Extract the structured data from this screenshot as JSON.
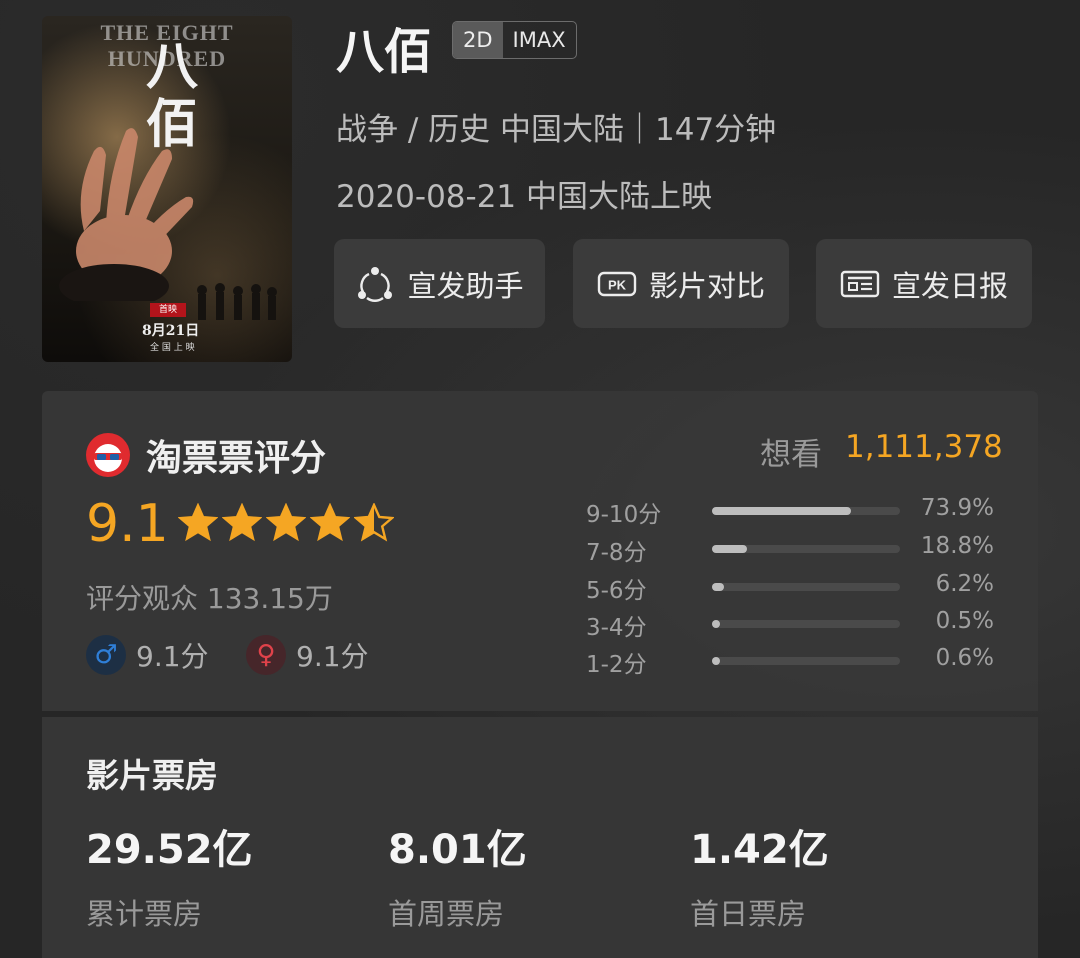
{
  "poster": {
    "title_en": "THE EIGHT HUNDRED",
    "title_cn": "八佰",
    "stamp": "首映",
    "date": "8月21日",
    "release_note": "全 国 上 映"
  },
  "movie": {
    "title": "八佰",
    "tag_2d": "2D",
    "tag_imax": "IMAX",
    "meta_line1": "战争 / 历史 中国大陆｜147分钟",
    "meta_line2": "2020-08-21 中国大陆上映"
  },
  "actions": [
    {
      "label": "宣发助手",
      "icon": "share-triangle-icon"
    },
    {
      "label": "影片对比",
      "icon": "pk-icon"
    },
    {
      "label": "宣发日报",
      "icon": "report-card-icon"
    }
  ],
  "rating": {
    "source": "淘票票评分",
    "score": "9.1",
    "stars": 4.5,
    "voters": "评分观众 133.15万",
    "male_score": "9.1分",
    "female_score": "9.1分",
    "want_label": "想看",
    "want_value": "1,111,378",
    "distribution": [
      {
        "label": "9-10分",
        "pct": "73.9%",
        "value": 73.9
      },
      {
        "label": "7-8分",
        "pct": "18.8%",
        "value": 18.8
      },
      {
        "label": "5-6分",
        "pct": "6.2%",
        "value": 6.2
      },
      {
        "label": "3-4分",
        "pct": "0.5%",
        "value": 0.5
      },
      {
        "label": "1-2分",
        "pct": "0.6%",
        "value": 0.6
      }
    ]
  },
  "box_office": {
    "title": "影片票房",
    "items": [
      {
        "value": "29.52亿",
        "label": "累计票房"
      },
      {
        "value": "8.01亿",
        "label": "首周票房"
      },
      {
        "value": "1.42亿",
        "label": "首日票房"
      }
    ]
  },
  "colors": {
    "accent": "#f5a623",
    "male": "#2f7fd8",
    "female": "#e0424a"
  }
}
